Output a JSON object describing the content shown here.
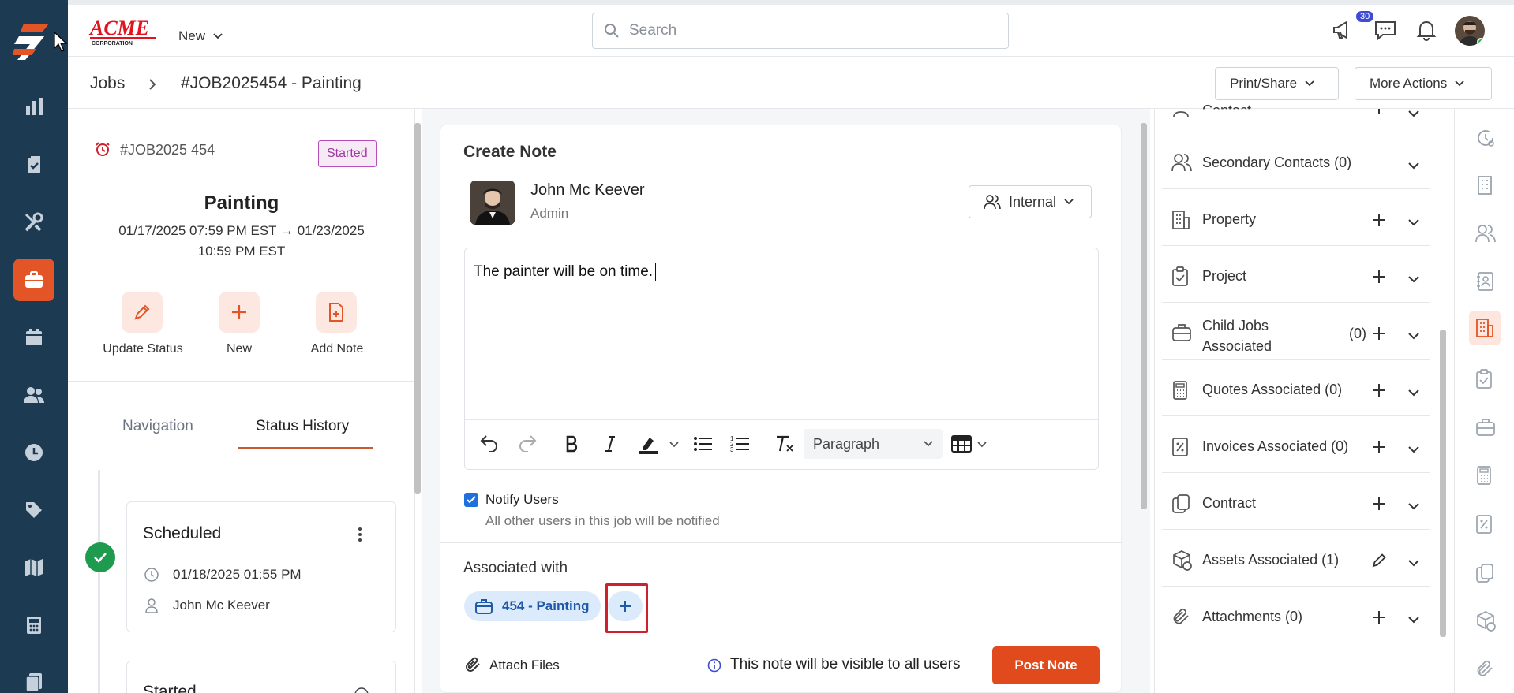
{
  "topbar": {
    "new_label": "New",
    "search_placeholder": "Search",
    "notification_count": "30"
  },
  "breadcrumb": {
    "root": "Jobs",
    "current": "#JOB2025454 - Painting"
  },
  "header_actions": {
    "print_share": "Print/Share",
    "more_actions": "More Actions"
  },
  "job": {
    "number": "#JOB2025 454",
    "status": "Started",
    "title": "Painting",
    "date_line1": "01/17/2025 07:59 PM EST → 01/23/2025",
    "date_line2": "10:59 PM EST",
    "actions": [
      "Update Status",
      "New",
      "Add Note"
    ],
    "tabs": [
      "Navigation",
      "Status History"
    ],
    "history": [
      {
        "status": "Scheduled",
        "datetime": "01/18/2025 01:55 PM",
        "user": "John Mc Keever"
      },
      {
        "status": "Started"
      }
    ]
  },
  "note": {
    "title": "Create Note",
    "author_name": "John Mc Keever",
    "author_role": "Admin",
    "visibility": "Internal",
    "body": "The painter will be on time.",
    "paragraph_style": "Paragraph",
    "notify_label": "Notify Users",
    "notify_hint": "All other users in this job will be notified",
    "notify_checked": true,
    "associated_label": "Associated with",
    "associated_chip": "454 - Painting",
    "attach_label": "Attach Files",
    "visibility_note": "This note will be visible to all users",
    "post_label": "Post Note"
  },
  "right_panel": {
    "top_cut_label": "Contact",
    "rows": [
      {
        "label": "Secondary Contacts (0)",
        "icon": "users-icon",
        "action": "none"
      },
      {
        "label": "Property",
        "icon": "building-icon",
        "action": "plus"
      },
      {
        "label": "Project",
        "icon": "clipboard-check-icon",
        "action": "plus"
      },
      {
        "label": "Child Jobs Associated",
        "count": "(0)",
        "icon": "briefcase-icon",
        "action": "plus"
      },
      {
        "label": "Quotes Associated (0)",
        "icon": "calculator-icon",
        "action": "plus"
      },
      {
        "label": "Invoices Associated (0)",
        "icon": "invoice-icon",
        "action": "plus"
      },
      {
        "label": "Contract",
        "icon": "copy-icon",
        "action": "plus"
      },
      {
        "label": "Assets Associated (1)",
        "icon": "box-icon",
        "action": "edit"
      },
      {
        "label": "Attachments (0)",
        "icon": "paperclip-icon",
        "action": "plus"
      }
    ]
  },
  "colors": {
    "sidebar": "#1c3a52",
    "accent": "#e35427",
    "status_started": "#a0369e",
    "link_blue": "#1e5aa8",
    "success": "#1e9b4f"
  }
}
